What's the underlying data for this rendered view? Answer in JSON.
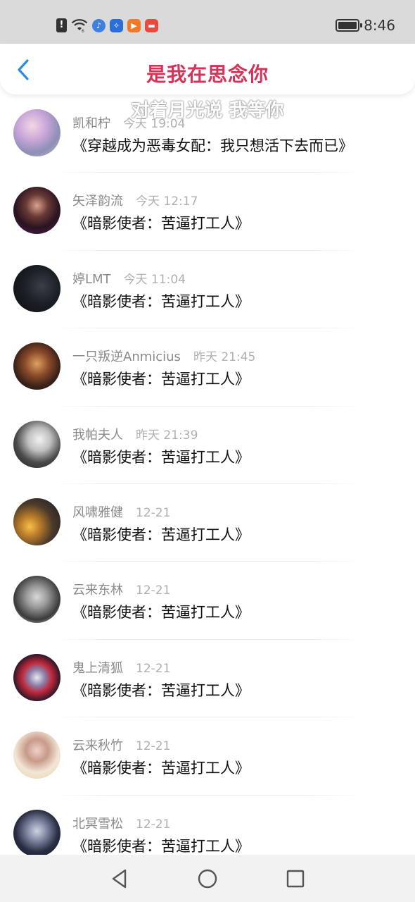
{
  "status_bar": {
    "time": "8:46",
    "icons": [
      "alert-icon",
      "wifi-icon",
      "music-app-icon",
      "bulb-app-icon",
      "video-app-icon",
      "news-app-icon",
      "battery-icon"
    ]
  },
  "header": {
    "title": "是我在思念你",
    "danmaku": "对着月光说 我等你"
  },
  "colors": {
    "title": "#d5345a",
    "back_arrow": "#2a8ae6"
  },
  "list": [
    {
      "name": "凯和柠",
      "time": "今天 19:04",
      "book": "《穿越成为恶毒女配：我只想活下去而已》"
    },
    {
      "name": "矢泽韵流",
      "time": "今天 12:17",
      "book": "《暗影使者：苦逼打工人》"
    },
    {
      "name": "婷LMT",
      "time": "今天 11:04",
      "book": "《暗影使者：苦逼打工人》"
    },
    {
      "name": "一只叛逆Anmicius",
      "time": "昨天 21:45",
      "book": "《暗影使者：苦逼打工人》"
    },
    {
      "name": "我帕夫人",
      "time": "昨天 21:39",
      "book": "《暗影使者：苦逼打工人》"
    },
    {
      "name": "风啸雅健",
      "time": "12-21",
      "book": "《暗影使者：苦逼打工人》"
    },
    {
      "name": "云来东林",
      "time": "12-21",
      "book": "《暗影使者：苦逼打工人》"
    },
    {
      "name": "鬼上清狐",
      "time": "12-21",
      "book": "《暗影使者：苦逼打工人》"
    },
    {
      "name": "云来秋竹",
      "time": "12-21",
      "book": "《暗影使者：苦逼打工人》"
    },
    {
      "name": "北冥雪松",
      "time": "12-21",
      "book": "《暗影使者：苦逼打工人》"
    }
  ],
  "nav_bar": {
    "buttons": [
      "back-nav-icon",
      "home-nav-icon",
      "recents-nav-icon"
    ]
  }
}
